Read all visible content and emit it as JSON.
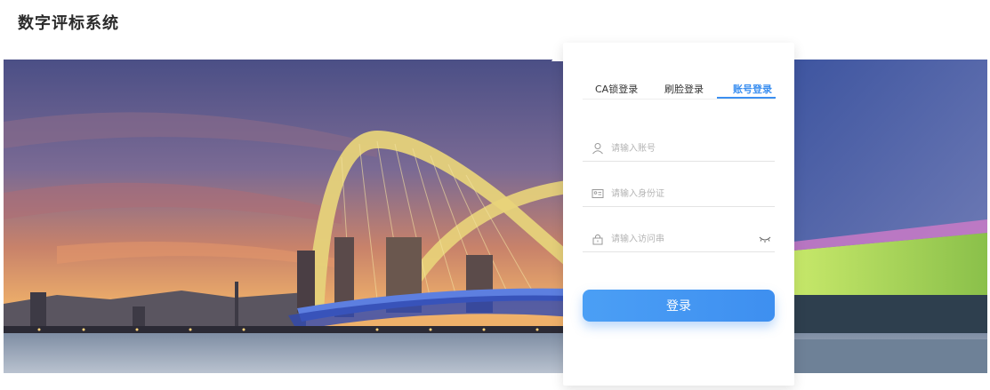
{
  "app": {
    "title": "数字评标系统"
  },
  "login": {
    "tabs": [
      {
        "label": "CA锁登录",
        "active": false
      },
      {
        "label": "刷脸登录",
        "active": false
      },
      {
        "label": "账号登录",
        "active": true
      }
    ],
    "fields": {
      "account": {
        "placeholder": "请输入账号",
        "icon": "user-icon",
        "value": ""
      },
      "id_card": {
        "placeholder": "请输入身份证",
        "icon": "id-card-icon",
        "value": ""
      },
      "access_code": {
        "placeholder": "请输入访问串",
        "icon": "lock-icon",
        "value": "",
        "toggle_icon": "eye-closed-icon"
      }
    },
    "submit_label": "登录"
  },
  "colors": {
    "accent": "#3b8ff0",
    "title": "#2b2b2b",
    "placeholder": "#b4b4b4"
  },
  "banner": {
    "subject": "night-bridge-photo"
  }
}
